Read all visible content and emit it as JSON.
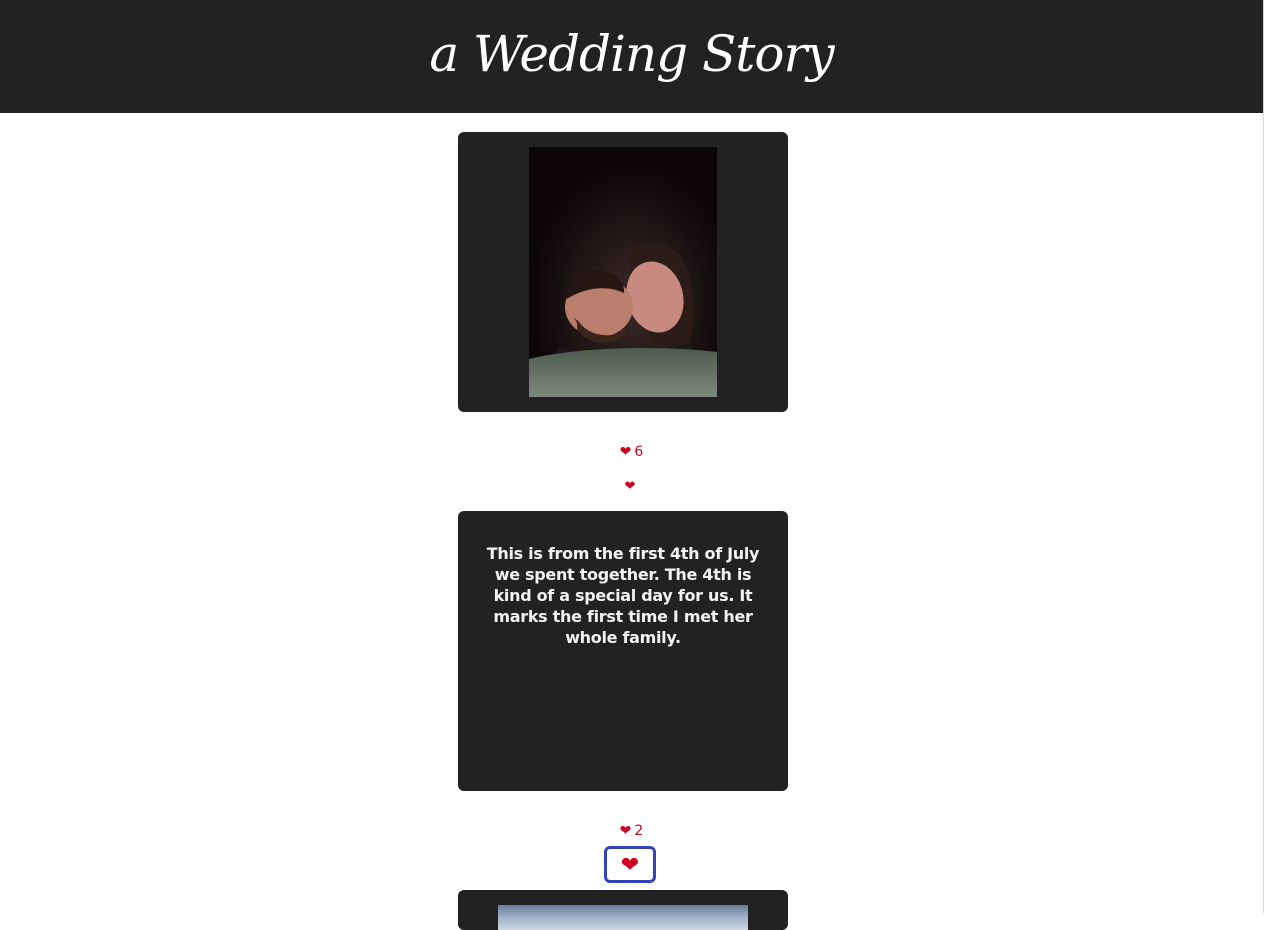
{
  "header": {
    "title": "a Wedding Story"
  },
  "posts": [
    {
      "type": "photo",
      "image_description_icon": "photo-couple-kiss",
      "likes_count": "6",
      "like_icon": "heart-icon"
    },
    {
      "type": "text",
      "text": "This is from the first 4th of July we spent together. The 4th is kind of a special day for us. It marks the first time I met her whole family.",
      "likes_count": "2",
      "like_icon": "heart-icon"
    },
    {
      "type": "photo",
      "image_description_icon": "photo-partial"
    }
  ],
  "colors": {
    "header_bg": "#222222",
    "card_bg": "#222222",
    "heart": "#cc0022",
    "focus_ring": "#3344bb"
  }
}
